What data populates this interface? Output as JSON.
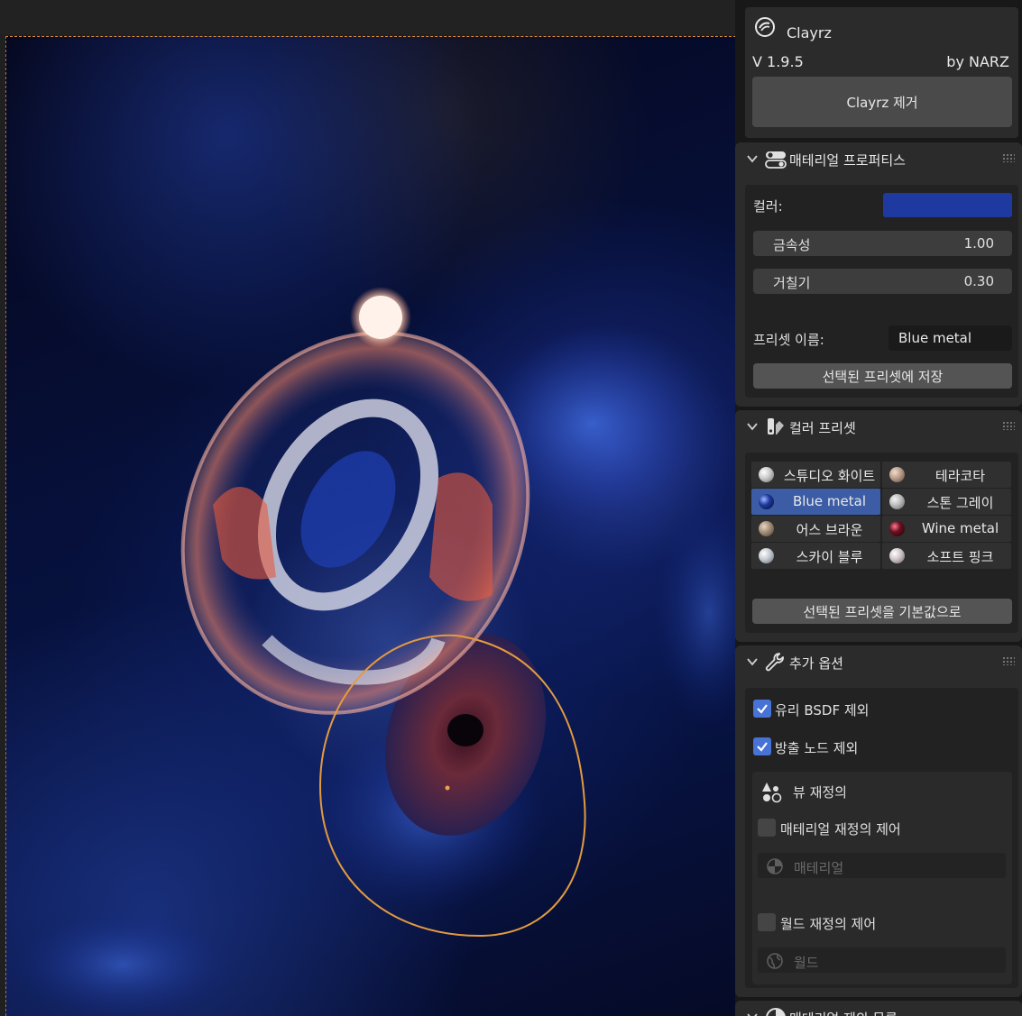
{
  "addon": {
    "title": "Clayrz",
    "version": "V 1.9.5",
    "author": "by NARZ",
    "remove_button": "Clayrz 제거"
  },
  "material_properties": {
    "title": "매테리얼 프로퍼티스",
    "color_label": "컬러:",
    "color_value": "#1e3aa0",
    "metallic_label": "금속성",
    "metallic_value": "1.00",
    "roughness_label": "거칠기",
    "roughness_value": "0.30",
    "preset_name_label": "프리셋 이름:",
    "preset_name_value": "Blue metal",
    "save_button": "선택된 프리셋에 저장"
  },
  "color_presets": {
    "title": "컬러 프리셋",
    "items": [
      {
        "label": "스튜디오 화이트",
        "ball": "#c8c8c8",
        "selected": false
      },
      {
        "label": "테라코타",
        "ball": "#b89a88",
        "selected": false
      },
      {
        "label": "Blue metal",
        "ball": "#1e3aa0",
        "selected": true
      },
      {
        "label": "스톤 그레이",
        "ball": "#b9b9b9",
        "selected": false
      },
      {
        "label": "어스 브라운",
        "ball": "#a08b75",
        "selected": false
      },
      {
        "label": "Wine metal",
        "ball": "#6a0f20",
        "selected": false
      },
      {
        "label": "스카이 블루",
        "ball": "#c2c8cf",
        "selected": false
      },
      {
        "label": "소프트 핑크",
        "ball": "#cdc3c6",
        "selected": false
      }
    ],
    "reset_button": "선택된 프리셋을 기본값으로"
  },
  "extra_options": {
    "title": "추가 옵션",
    "exclude_glass_label": "유리 BSDF 제외",
    "exclude_glass_checked": true,
    "exclude_emission_label": "방출 노드 제외",
    "exclude_emission_checked": true,
    "view_override_title": "뷰 재정의",
    "material_override_label": "매테리얼 재정의 제어",
    "material_override_checked": false,
    "material_field_placeholder": "매테리얼",
    "world_override_label": "월드 재정의 제어",
    "world_override_checked": false,
    "world_field_placeholder": "월드"
  },
  "next_section": {
    "title": "매테리얼 제외 목록"
  }
}
